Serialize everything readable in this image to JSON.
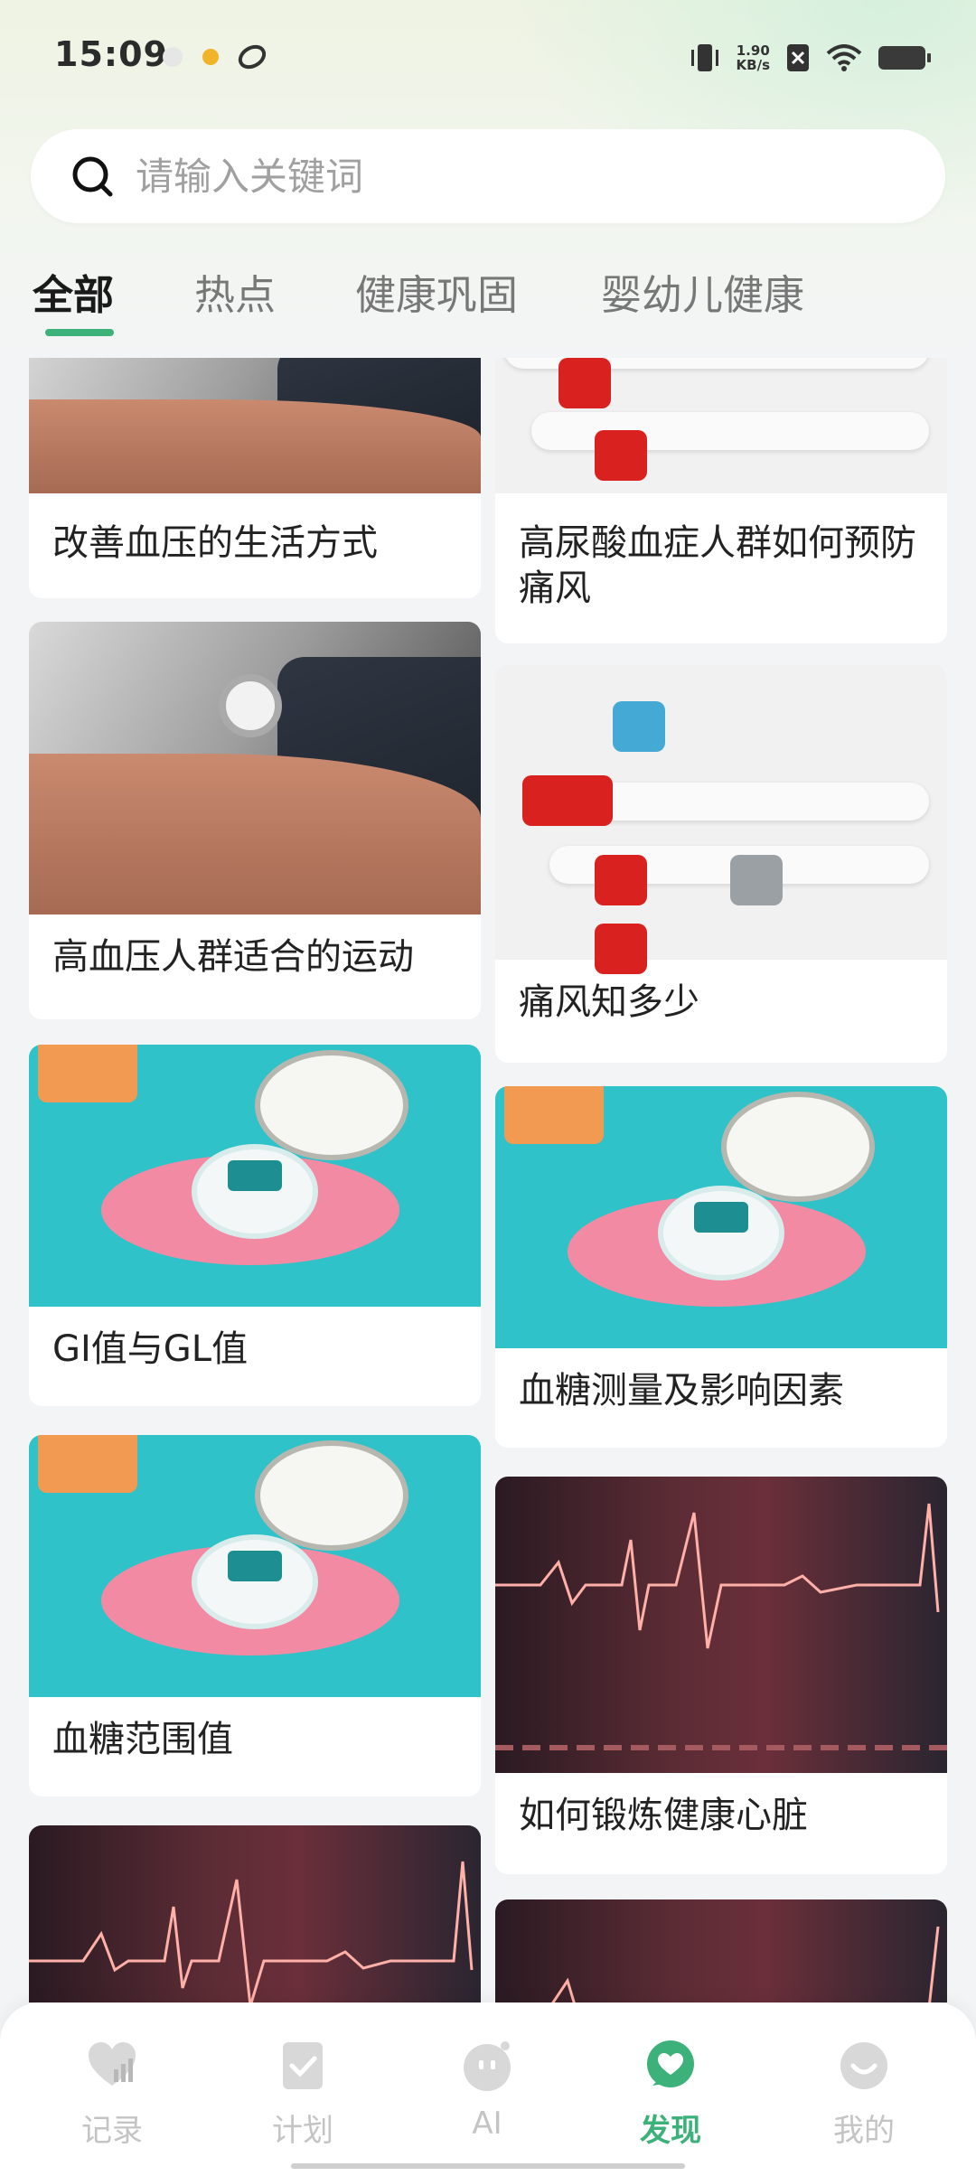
{
  "status_bar": {
    "time": "15:09",
    "net_speed_value": "1.90",
    "net_speed_unit": "KB/s"
  },
  "search": {
    "placeholder": "请输入关键词",
    "value": ""
  },
  "tabs": [
    {
      "label": "全部",
      "active": true
    },
    {
      "label": "热点",
      "active": false
    },
    {
      "label": "健康巩固",
      "active": false
    },
    {
      "label": "婴幼儿健康",
      "active": false
    }
  ],
  "feed": {
    "left": [
      {
        "title": "改善血压的生活方式",
        "image": "blood-pressure-cuff"
      },
      {
        "title": "高血压人群适合的运动",
        "image": "blood-pressure-cuff"
      },
      {
        "title": "GI值与GL值",
        "image": "glucose-meter-plate"
      },
      {
        "title": "血糖范围值",
        "image": "glucose-meter-plate"
      },
      {
        "title": "",
        "image": "heart-rate-wave"
      }
    ],
    "right": [
      {
        "title": "高尿酸血症人群如何预防痛风",
        "image": "blood-test-tubes"
      },
      {
        "title": "痛风知多少",
        "image": "blood-test-tubes"
      },
      {
        "title": "血糖测量及影响因素",
        "image": "glucose-meter-plate"
      },
      {
        "title": "如何锻炼健康心脏",
        "image": "heart-rate-wave"
      },
      {
        "title": "",
        "image": "heart-rate-wave"
      }
    ]
  },
  "bottom_nav": [
    {
      "label": "记录",
      "icon": "heart-chart-icon",
      "active": false
    },
    {
      "label": "计划",
      "icon": "clipboard-check-icon",
      "active": false
    },
    {
      "label": "AI",
      "icon": "robot-face-icon",
      "active": false
    },
    {
      "label": "发现",
      "icon": "heart-bubble-icon",
      "active": true
    },
    {
      "label": "我的",
      "icon": "smile-face-icon",
      "active": false
    }
  ],
  "colors": {
    "accent": "#3cb179",
    "inactive_nav": "#c4c4c4",
    "background": "#f3f4f6"
  }
}
